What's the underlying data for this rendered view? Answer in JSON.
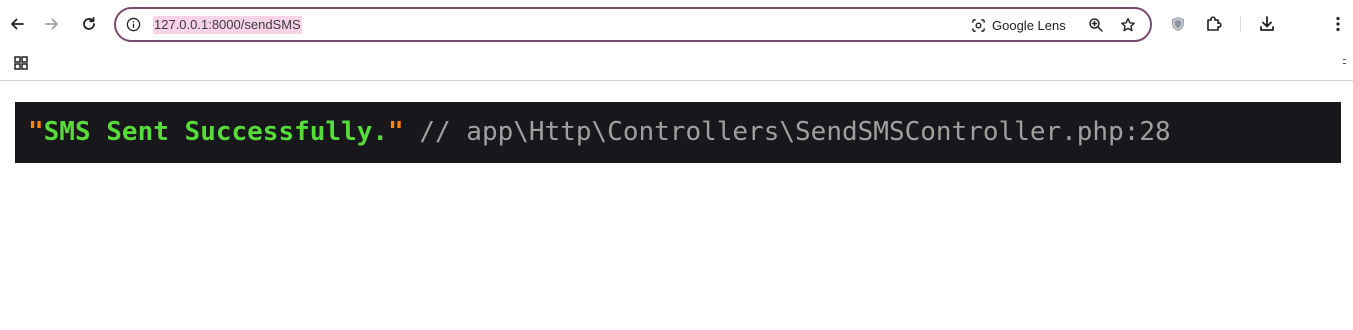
{
  "browser": {
    "url": "127.0.0.1:8000/sendSMS",
    "lens_label": "Google Lens",
    "icons": {
      "back": "back-arrow-icon",
      "forward": "forward-arrow-icon",
      "reload": "reload-icon",
      "site_info": "info-icon",
      "lens": "camera-lens-icon",
      "zoom": "zoom-icon",
      "bookmark": "star-icon",
      "extension": "shield-icon",
      "extensions": "puzzle-icon",
      "downloads": "download-icon",
      "menu": "kebab-menu-icon",
      "apps": "apps-grid-icon"
    },
    "accent_color": "#7a4a6e",
    "url_highlight_color": "#f8d3e8"
  },
  "dump": {
    "open_quote": "\"",
    "message": "SMS Sent Successfully.",
    "close_quote": "\"",
    "source": " // app\\Http\\Controllers\\SendSMSController.php:28",
    "colors": {
      "background": "#18171b",
      "quote": "#ff8400",
      "string": "#56db3a",
      "comment": "#a0a0a0"
    }
  }
}
